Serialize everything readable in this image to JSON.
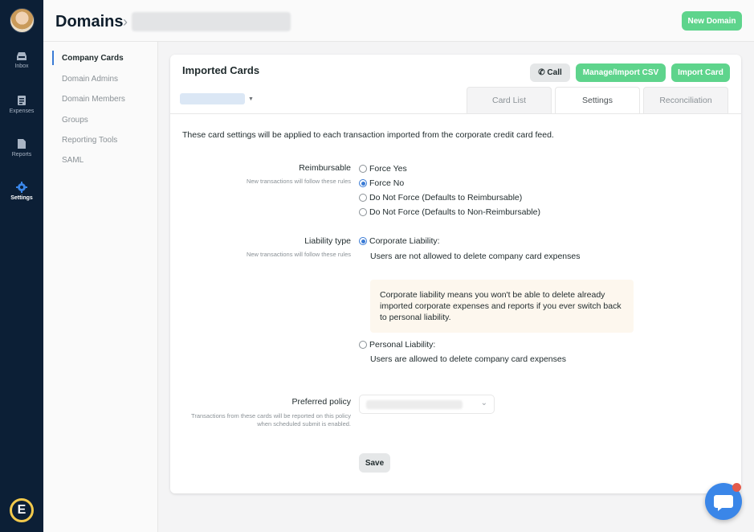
{
  "rail": {
    "items": [
      {
        "label": "Inbox",
        "icon": "inbox-icon"
      },
      {
        "label": "Expenses",
        "icon": "expenses-icon"
      },
      {
        "label": "Reports",
        "icon": "reports-icon"
      },
      {
        "label": "Settings",
        "icon": "gear-icon"
      }
    ],
    "active": "Settings",
    "logo": "E"
  },
  "header": {
    "title": "Domains",
    "separator": "›",
    "new_domain": "New Domain"
  },
  "subnav": {
    "items": [
      "Company Cards",
      "Domain Admins",
      "Domain Members",
      "Groups",
      "Reporting Tools",
      "SAML"
    ],
    "active": "Company Cards"
  },
  "card": {
    "title": "Imported Cards",
    "call": "Call",
    "manage_csv": "Manage/Import CSV",
    "import_card": "Import Card",
    "tabs": [
      "Card List",
      "Settings",
      "Reconciliation"
    ],
    "active_tab": "Settings",
    "description": "These card settings will be applied to each transaction imported from the corporate credit card feed."
  },
  "reimbursable": {
    "label": "Reimbursable",
    "sub": "New transactions will follow these rules",
    "options": [
      "Force Yes",
      "Force No",
      "Do Not Force (Defaults to Reimbursable)",
      "Do Not Force (Defaults to Non-Reimbursable)"
    ],
    "selected": "Force No"
  },
  "liability": {
    "label": "Liability type",
    "sub": "New transactions will follow these rules",
    "corporate": "Corporate Liability:",
    "corporate_desc": "Users are not allowed to delete company card expenses",
    "note": "Corporate liability means you won't be able to delete already imported corporate expenses and reports if you ever switch back to personal liability.",
    "personal": "Personal Liability:",
    "personal_desc": "Users are allowed to delete company card expenses",
    "selected": "Corporate Liability:"
  },
  "policy": {
    "label": "Preferred policy",
    "sub": "Transactions from these cards will be reported on this policy when scheduled submit is enabled."
  },
  "save": "Save",
  "colors": {
    "rail": "#0c1f36",
    "green": "#5ed48c",
    "accent": "#3a7bd5",
    "note_bg": "#fdf7ee",
    "chat": "#3a86e8"
  }
}
